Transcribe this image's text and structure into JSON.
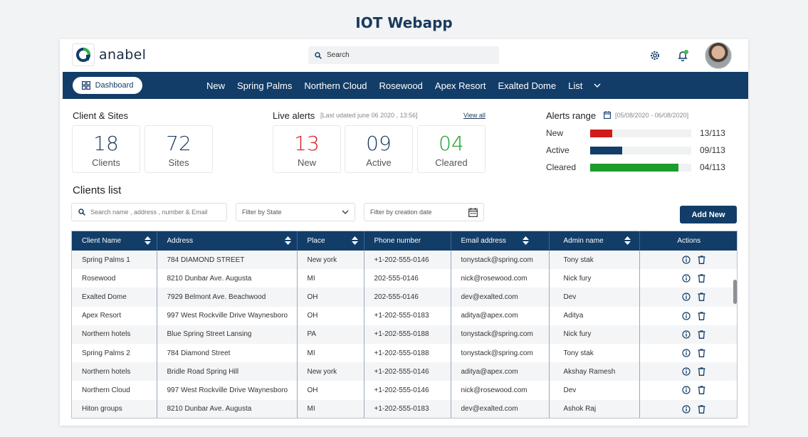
{
  "caption": "IOT Webapp",
  "brand": {
    "name": "anabel"
  },
  "search": {
    "placeholder": "Search"
  },
  "colors": {
    "primary": "#123d68",
    "alert_new": "#d11a1a",
    "alert_cleared": "#1b9c2c",
    "notification_dot": "#37c44a"
  },
  "nav": {
    "dashboard_label": "Dashboard",
    "items": [
      "New",
      "Spring Palms",
      "Northern Cloud",
      "Rosewood",
      "Apex Resort",
      "Exalted Dome",
      "List"
    ]
  },
  "client_sites": {
    "title": "Client & Sites",
    "clients": {
      "value": "18",
      "label": "Clients"
    },
    "sites": {
      "value": "72",
      "label": "Sites"
    }
  },
  "live_alerts": {
    "title": "Live alerts",
    "updated": "[Last udated june 06 2020 , 13:56]",
    "view_all": "View all",
    "new": {
      "value": "13",
      "label": "New"
    },
    "active": {
      "value": "09",
      "label": "Active"
    },
    "cleared": {
      "value": "04",
      "label": "Cleared"
    }
  },
  "alerts_range": {
    "title": "Alerts range",
    "dates": "[05/08/2020 - 06/08/2020]",
    "rows": [
      {
        "label": "New",
        "value": "13/113",
        "fraction": 0.22,
        "color": "#d11a1a"
      },
      {
        "label": "Active",
        "value": "09/113",
        "fraction": 0.32,
        "color": "#123d68"
      },
      {
        "label": "Cleared",
        "value": "04/113",
        "fraction": 0.87,
        "color": "#1b9c2c"
      }
    ]
  },
  "clients_list": {
    "title": "Clients list",
    "search_placeholder": "Search name , address , number & Email",
    "filter_state": "Filter by State",
    "filter_date": "Filter by creation date",
    "add_new": "Add New",
    "columns": [
      "Client Name",
      "Address",
      "Place",
      "Phone number",
      "Email address",
      "Admin name",
      "Actions"
    ],
    "rows": [
      [
        "Spring Palms 1",
        "784  DIAMOND STREET",
        "New york",
        "+1-202-555-0146",
        "tonystack@spring.com",
        "Tony stak"
      ],
      [
        "Rosewood",
        "8210 Dunbar Ave. Augusta",
        "MI",
        "202-555-0146",
        "nick@rosewood.com",
        "Nick fury"
      ],
      [
        "Exalted Dome",
        "7929 Belmont Ave. Beachwood",
        "OH",
        "202-555-0146",
        "dev@exalted.com",
        "Dev"
      ],
      [
        "Apex Resort",
        "997 West Rockville Drive Waynesboro",
        "OH",
        "+1-202-555-0183",
        "aditya@apex.com",
        "Aditya"
      ],
      [
        "Northern hotels",
        "Blue Spring Street Lansing",
        "PA",
        "+1-202-555-0188",
        "tonystack@spring.com",
        "Nick fury"
      ],
      [
        "Spring Palms 2",
        "784  Diamond Street",
        "MI",
        "+1-202-555-0188",
        "tonystack@spring.com",
        "Tony stak"
      ],
      [
        "Northern hotels",
        "Bridle Road Spring Hill",
        "New york",
        "+1-202-555-0146",
        "aditya@apex.com",
        "Akshay Ramesh"
      ],
      [
        "Northern Cloud",
        "997 West Rockville Drive Waynesboro",
        "OH",
        "+1-202-555-0146",
        "nick@rosewood.com",
        "Dev"
      ],
      [
        "Hiton groups",
        "8210 Dunbar Ave. Augusta",
        "MI",
        "+1-202-555-0183",
        "dev@exalted.com",
        "Ashok Raj"
      ]
    ]
  }
}
